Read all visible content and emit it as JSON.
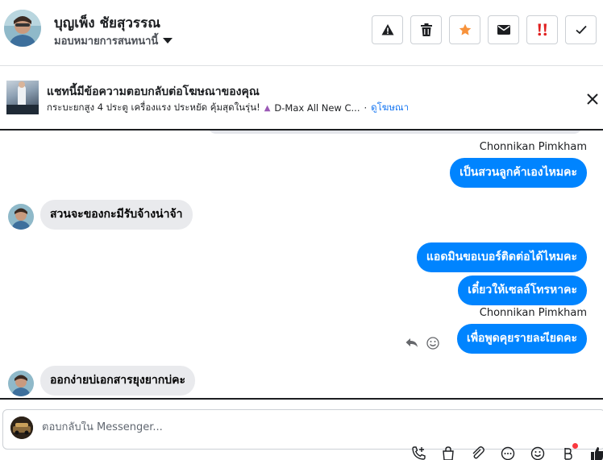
{
  "header": {
    "contact_name": "บุญเพ็ง ชัยสุวรรณ",
    "assign_label": "มอบหมายการสนทนานี้",
    "actions": [
      {
        "name": "report-spam-button",
        "icon": "warning-icon"
      },
      {
        "name": "delete-button",
        "icon": "trash-icon"
      },
      {
        "name": "star-button",
        "icon": "star-icon"
      },
      {
        "name": "mark-unread-button",
        "icon": "envelope-icon"
      },
      {
        "name": "mark-important-button",
        "icon": "double-exclamation-icon"
      },
      {
        "name": "mark-done-button",
        "icon": "check-icon"
      }
    ]
  },
  "banner": {
    "title": "แชทนี้มีข้อความตอบกลับต่อโฆษณาของคุณ",
    "ad_text": "กระบะยกสูง 4 ประตู เครื่องแรง ประหยัด คุ้มสุดในรุ่น!",
    "ad_name": "D-Max All New C...",
    "separator": "·",
    "view_ad": "ดูโฆษณา"
  },
  "messages": {
    "sender_1": "Chonnikan Pimkham",
    "out_1": "เป็นสวนลูกค้าเองไหมคะ",
    "in_1": "สวนจะของกะมีรับจ้างน่าจ้า",
    "out_2": "แอดมินขอเบอร์ติดต่อได้ไหมคะ",
    "out_3": "เดี๋ยวให้เซลล์โทรหาคะ",
    "sender_2": "Chonnikan Pimkham",
    "out_4": "เพื่อพูดคุยรายละเียดคะ",
    "in_2": "ออกง่ายบ่เอกสารยุงยากบ่คะ"
  },
  "composer": {
    "placeholder": "ตอบกลับใน Messenger..."
  },
  "colors": {
    "outgoing_bubble": "#0084ff",
    "incoming_bubble": "#e9eaed",
    "star_accent": "#f7923b",
    "important_accent": "#e02020",
    "link": "#1877f2"
  }
}
